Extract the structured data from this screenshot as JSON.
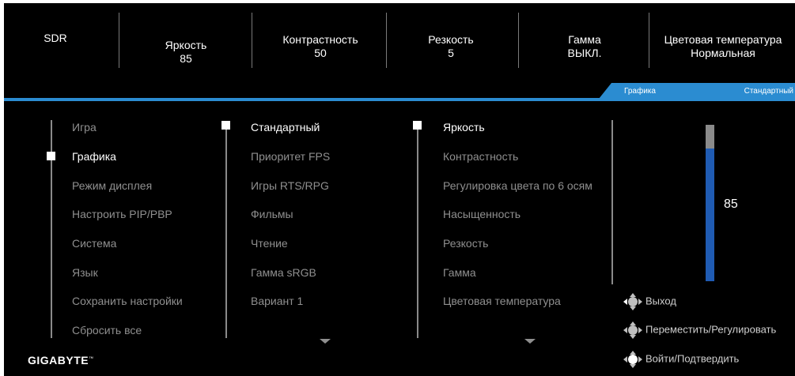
{
  "status_bar": [
    {
      "label": "SDR",
      "value": ""
    },
    {
      "label": "Яркость",
      "value": "85"
    },
    {
      "label": "Контрастность",
      "value": "50"
    },
    {
      "label": "Резкость",
      "value": "5"
    },
    {
      "label": "Гамма",
      "value": "ВЫКЛ."
    },
    {
      "label": "Цветовая температура",
      "value": "Нормальная"
    }
  ],
  "mode_tab": {
    "category": "Графика",
    "mode": "Стандартный"
  },
  "main_menu": {
    "items": [
      "Игра",
      "Графика",
      "Режим дисплея",
      "Настроить PIP/PBP",
      "Система",
      "Язык",
      "Сохранить настройки",
      "Сбросить все"
    ],
    "selected": "Графика"
  },
  "mode_menu": {
    "items": [
      "Стандартный",
      "Приоритет FPS",
      "Игры RTS/RPG",
      "Фильмы",
      "Чтение",
      "Гамма sRGB",
      "Вариант 1"
    ],
    "selected": "Стандартный"
  },
  "settings_menu": {
    "items": [
      "Яркость",
      "Контрастность",
      "Регулировка цвета по 6 осям",
      "Насыщенность",
      "Резкость",
      "Гамма",
      "Цветовая температура"
    ],
    "selected": "Яркость"
  },
  "value_slider": {
    "value": "85",
    "level": 0.85
  },
  "hints": [
    {
      "label": "Выход",
      "icon": "joystick-left-icon"
    },
    {
      "label": "Переместить/Регулировать",
      "icon": "joystick-move-icon"
    },
    {
      "label": "Войти/Подтвердить",
      "icon": "joystick-press-icon"
    }
  ],
  "brand": {
    "name": "GIGABYTE",
    "mark": "™"
  },
  "colors": {
    "accent": "#2b8cd1",
    "bar_fill": "#1f5bb3",
    "background": "#000000"
  }
}
